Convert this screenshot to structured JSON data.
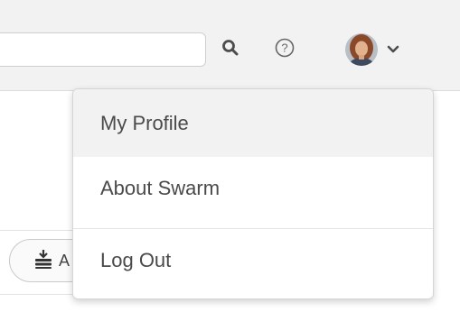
{
  "header": {
    "search": {
      "value": "",
      "placeholder": ""
    },
    "icons": {
      "search": "search-icon",
      "help": "help-circle-icon",
      "avatar": "user-avatar",
      "chevron": "chevron-down-icon"
    }
  },
  "user_menu": {
    "items": [
      {
        "label": "My Profile",
        "active": true
      },
      {
        "label": "About Swarm",
        "active": false
      },
      {
        "label": "Log Out",
        "active": false
      }
    ]
  },
  "toolbar": {
    "add_button_label": "A",
    "add_button_icon": "download-stack-icon"
  },
  "colors": {
    "header_bg": "#f2f2f2",
    "menu_hover_bg": "#f2f2f2",
    "text": "#4a4a4a",
    "icon": "#4d4d4d"
  }
}
